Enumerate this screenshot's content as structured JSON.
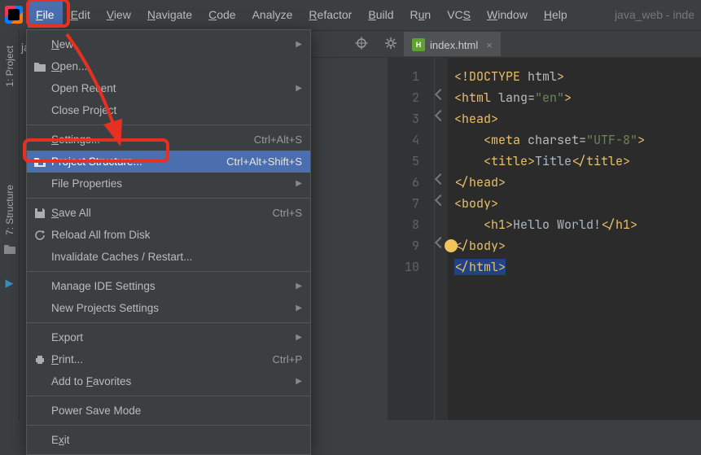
{
  "menubar": {
    "items": [
      {
        "label": "File",
        "mn_index": 0
      },
      {
        "label": "Edit",
        "mn_index": 0
      },
      {
        "label": "View",
        "mn_index": 0
      },
      {
        "label": "Navigate",
        "mn_index": 0
      },
      {
        "label": "Code",
        "mn_index": 0
      },
      {
        "label": "Analyze",
        "mn_index": -1
      },
      {
        "label": "Refactor",
        "mn_index": 0
      },
      {
        "label": "Build",
        "mn_index": 0
      },
      {
        "label": "Run",
        "mn_index": 1
      },
      {
        "label": "VCS",
        "mn_index": 2
      },
      {
        "label": "Window",
        "mn_index": 0
      },
      {
        "label": "Help",
        "mn_index": 0
      }
    ],
    "title": "java_web - inde"
  },
  "dropdown": {
    "groups": [
      [
        {
          "label": "New",
          "mn_index": 0,
          "submenu": true
        },
        {
          "label": "Open...",
          "mn_index": 0,
          "icon": "open-icon"
        },
        {
          "label": "Open Recent",
          "mn_index": -1,
          "submenu": true
        },
        {
          "label": "Close Project",
          "mn_index": -1
        }
      ],
      [
        {
          "label": "Settings...",
          "mn_index": 0,
          "shortcut": "Ctrl+Alt+S"
        },
        {
          "label": "Project Structure...",
          "mn_index": -1,
          "shortcut": "Ctrl+Alt+Shift+S",
          "icon": "project-structure-icon",
          "selected": true
        },
        {
          "label": "File Properties",
          "mn_index": -1,
          "submenu": true
        }
      ],
      [
        {
          "label": "Save All",
          "mn_index": 0,
          "shortcut": "Ctrl+S",
          "icon": "save-icon"
        },
        {
          "label": "Reload All from Disk",
          "mn_index": -1,
          "icon": "reload-icon"
        },
        {
          "label": "Invalidate Caches / Restart...",
          "mn_index": -1
        }
      ],
      [
        {
          "label": "Manage IDE Settings",
          "mn_index": -1,
          "submenu": true
        },
        {
          "label": "New Projects Settings",
          "mn_index": -1,
          "submenu": true
        }
      ],
      [
        {
          "label": "Export",
          "mn_index": -1,
          "submenu": true
        },
        {
          "label": "Print...",
          "mn_index": 0,
          "shortcut": "Ctrl+P",
          "icon": "print-icon"
        },
        {
          "label": "Add to Favorites",
          "mn_index": 7,
          "submenu": true
        }
      ],
      [
        {
          "label": "Power Save Mode",
          "mn_index": -1
        }
      ],
      [
        {
          "label": "Exit",
          "mn_index": 1
        }
      ]
    ]
  },
  "sidebar": {
    "project_label": "1: Project",
    "structure_label": "7: Structure"
  },
  "project_area": {
    "nav_label": "jav"
  },
  "tabs": [
    {
      "label": "index.html"
    }
  ],
  "editor": {
    "lines": [
      {
        "n": 1,
        "ind": 0,
        "parts": [
          {
            "t": "<!DOCTYPE ",
            "c": "tag"
          },
          {
            "t": "html",
            "c": "attr"
          },
          {
            "t": ">",
            "c": "tag"
          }
        ]
      },
      {
        "n": 2,
        "ind": 0,
        "mark": true,
        "parts": [
          {
            "t": "<html ",
            "c": "tag"
          },
          {
            "t": "lang=",
            "c": "attr"
          },
          {
            "t": "\"en\"",
            "c": "str"
          },
          {
            "t": ">",
            "c": "tag"
          }
        ]
      },
      {
        "n": 3,
        "ind": 0,
        "mark": true,
        "parts": [
          {
            "t": "<head>",
            "c": "tag"
          }
        ]
      },
      {
        "n": 4,
        "ind": 1,
        "parts": [
          {
            "t": "<meta ",
            "c": "tag"
          },
          {
            "t": "charset=",
            "c": "attr"
          },
          {
            "t": "\"UTF-8\"",
            "c": "str"
          },
          {
            "t": ">",
            "c": "tag"
          }
        ]
      },
      {
        "n": 5,
        "ind": 1,
        "parts": [
          {
            "t": "<title>",
            "c": "tag"
          },
          {
            "t": "Title",
            "c": "txt"
          },
          {
            "t": "</title>",
            "c": "tag"
          }
        ]
      },
      {
        "n": 6,
        "ind": 0,
        "mark": true,
        "parts": [
          {
            "t": "</head>",
            "c": "tag"
          }
        ]
      },
      {
        "n": 7,
        "ind": 0,
        "mark": true,
        "parts": [
          {
            "t": "<body>",
            "c": "tag"
          }
        ]
      },
      {
        "n": 8,
        "ind": 1,
        "parts": [
          {
            "t": "<h1>",
            "c": "tag"
          },
          {
            "t": "Hello World!",
            "c": "txt"
          },
          {
            "t": "</h1>",
            "c": "tag"
          }
        ]
      },
      {
        "n": 9,
        "ind": 0,
        "mark": true,
        "parts": [
          {
            "t": "</body>",
            "c": "tag"
          }
        ]
      },
      {
        "n": 10,
        "ind": 0,
        "caret": true,
        "parts": [
          {
            "t": "</html>",
            "c": "tag"
          }
        ]
      }
    ]
  },
  "annotations": {
    "highlight_color": "#e63022"
  }
}
